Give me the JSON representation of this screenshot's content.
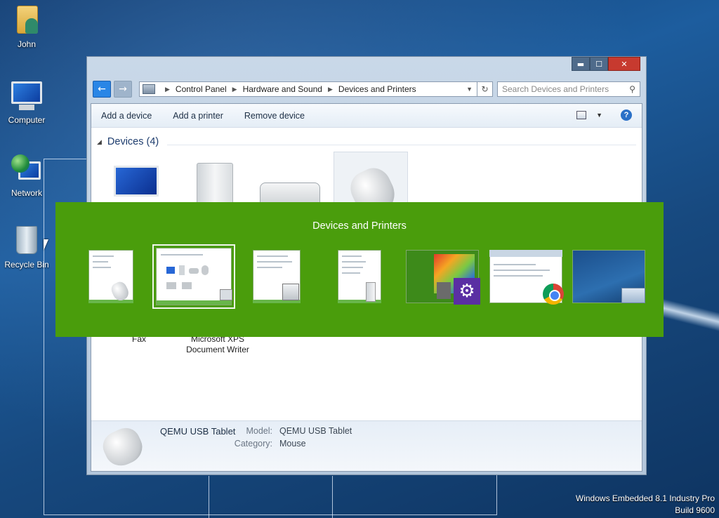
{
  "desktop": {
    "icons": [
      {
        "label": "John",
        "icon": "user-folder-icon"
      },
      {
        "label": "Computer",
        "icon": "computer-icon"
      },
      {
        "label": "Network",
        "icon": "network-icon"
      },
      {
        "label": "Recycle Bin",
        "icon": "recycle-bin-icon"
      }
    ],
    "branding": {
      "line1": "Windows Embedded 8.1 Industry Pro",
      "line2": "Build 9600"
    }
  },
  "window": {
    "controls": {
      "minimize": "▬",
      "maximize": "☐",
      "close": "✕"
    },
    "breadcrumb": [
      "Control Panel",
      "Hardware and Sound",
      "Devices and Printers"
    ],
    "search_placeholder": "Search Devices and Printers",
    "commands": [
      "Add a device",
      "Add a printer",
      "Remove device"
    ],
    "group_title": "Devices (4)",
    "partial_labels": {
      "fax": "Fax",
      "xps_line1": "Microsoft XPS",
      "xps_line2": "Document Writer"
    },
    "details": {
      "name": "QEMU USB Tablet",
      "model_label": "Model:",
      "model_value": "QEMU USB Tablet",
      "category_label": "Category:",
      "category_value": "Mouse"
    }
  },
  "switcher": {
    "title": "Devices and Printers",
    "accent": "#4a9d0c",
    "thumbnails": [
      "app-window",
      "devices-and-printers",
      "app-window",
      "app-window",
      "pc-settings",
      "chrome",
      "desktop"
    ]
  }
}
